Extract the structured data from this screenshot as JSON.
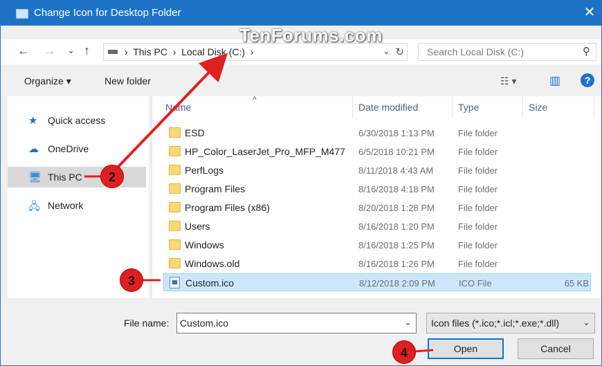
{
  "window": {
    "title": "Change Icon for Desktop Folder",
    "close_glyph": "✕",
    "accent": "#1e73c8"
  },
  "watermark": "TenForums.com",
  "nav": {
    "back_glyph": "←",
    "forward_glyph": "→",
    "recent_glyph": "⌄",
    "up_glyph": "↑",
    "breadcrumb": [
      "This PC",
      "Local Disk (C:)"
    ],
    "dropdown_glyph": "⌄",
    "refresh_glyph": "↻",
    "search_placeholder": "Search Local Disk (C:)",
    "search_glyph": "⚲"
  },
  "toolbar": {
    "organize_label": "Organize ▾",
    "new_folder_label": "New folder",
    "view_glyph": "☷ ▾",
    "pane_glyph": "▥",
    "help_label": "?"
  },
  "navpane": [
    {
      "label": "Quick access",
      "icon": "star-icon",
      "glyph": "★",
      "color": "#1e73c8"
    },
    {
      "label": "OneDrive",
      "icon": "cloud-icon",
      "glyph": "☁",
      "color": "#1e73c8"
    },
    {
      "label": "This PC",
      "icon": "computer-icon",
      "glyph": "🖥",
      "color": "#3f8fd0",
      "selected": true
    },
    {
      "label": "Network",
      "icon": "network-icon",
      "glyph": "🖧",
      "color": "#3f8fd0"
    }
  ],
  "columns": {
    "name": "Name",
    "date": "Date modified",
    "type": "Type",
    "size": "Size",
    "sort_glyph": "^"
  },
  "files": [
    {
      "name": "ESD",
      "date": "6/30/2018 1:13 PM",
      "type": "File folder",
      "size": "",
      "kind": "folder"
    },
    {
      "name": "HP_Color_LaserJet_Pro_MFP_M477",
      "date": "6/5/2018 10:21 PM",
      "type": "File folder",
      "size": "",
      "kind": "folder"
    },
    {
      "name": "PerfLogs",
      "date": "8/11/2018 4:43 AM",
      "type": "File folder",
      "size": "",
      "kind": "folder"
    },
    {
      "name": "Program Files",
      "date": "8/16/2018 4:18 PM",
      "type": "File folder",
      "size": "",
      "kind": "folder"
    },
    {
      "name": "Program Files (x86)",
      "date": "8/20/2018 1:28 PM",
      "type": "File folder",
      "size": "",
      "kind": "folder"
    },
    {
      "name": "Users",
      "date": "8/16/2018 1:20 PM",
      "type": "File folder",
      "size": "",
      "kind": "folder"
    },
    {
      "name": "Windows",
      "date": "8/16/2018 1:25 PM",
      "type": "File folder",
      "size": "",
      "kind": "folder"
    },
    {
      "name": "Windows.old",
      "date": "8/16/2018 1:26 PM",
      "type": "File folder",
      "size": "",
      "kind": "folder"
    },
    {
      "name": "Custom.ico",
      "date": "8/12/2018 2:09 PM",
      "type": "ICO File",
      "size": "65 KB",
      "kind": "ico",
      "selected": true
    }
  ],
  "footer": {
    "filename_label": "File name:",
    "filename_value": "Custom.ico",
    "filter_value": "Icon files (*.ico;*.icl;*.exe;*.dll)",
    "combo_glyph": "⌄",
    "open_label": "Open",
    "cancel_label": "Cancel"
  },
  "annotations": {
    "badge_color": "#e02020",
    "badges": [
      "2",
      "3",
      "4"
    ]
  }
}
